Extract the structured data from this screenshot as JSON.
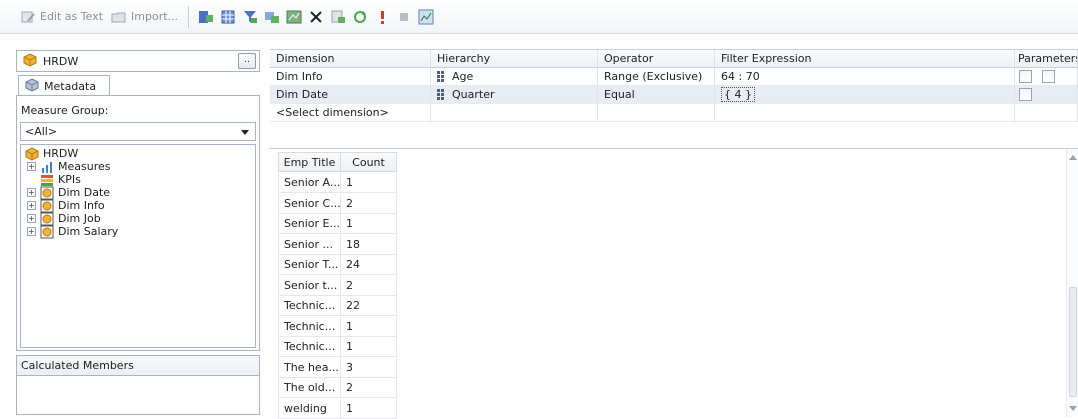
{
  "toolbar": {
    "edit_as_text": "Edit as Text",
    "import": "Import..."
  },
  "left_pane": {
    "cube": "HRDW",
    "browse": "..",
    "metadata_tab": "Metadata",
    "measure_group_label": "Measure Group:",
    "measure_group_value": "<All>",
    "tree": [
      {
        "label": "HRDW",
        "icon": "cube-icon",
        "expander": false,
        "indent": 0
      },
      {
        "label": "Measures",
        "icon": "measures-icon",
        "expander": true,
        "indent": 1
      },
      {
        "label": "KPIs",
        "icon": "kpi-icon",
        "expander": false,
        "indent": 1
      },
      {
        "label": "Dim Date",
        "icon": "dimension-icon",
        "expander": true,
        "indent": 1
      },
      {
        "label": "Dim Info",
        "icon": "dimension-icon",
        "expander": true,
        "indent": 1
      },
      {
        "label": "Dim Job",
        "icon": "dimension-icon",
        "expander": true,
        "indent": 1
      },
      {
        "label": "Dim Salary",
        "icon": "dimension-icon",
        "expander": true,
        "indent": 1
      }
    ],
    "calculated_members": "Calculated Members"
  },
  "filter_grid": {
    "columns": [
      "Dimension",
      "Hierarchy",
      "Operator",
      "Filter Expression",
      "Parameters"
    ],
    "rows": [
      {
        "dimension": "Dim Info",
        "hierarchy": "Age",
        "operator": "Range (Exclusive)",
        "expression": "64 : 70"
      },
      {
        "dimension": "Dim Date",
        "hierarchy": "Quarter",
        "operator": "Equal",
        "expression": "{ 4 }"
      }
    ],
    "select_dimension": "<Select dimension>"
  },
  "results": {
    "columns": [
      "Emp Title",
      "Count"
    ],
    "rows": [
      [
        "Senior A...",
        "1"
      ],
      [
        "Senior C...",
        "2"
      ],
      [
        "Senior E...",
        "1"
      ],
      [
        "Senior ...",
        "18"
      ],
      [
        "Senior T...",
        "24"
      ],
      [
        "Senior t...",
        "2"
      ],
      [
        "Technic...",
        "22"
      ],
      [
        "Technic...",
        "1"
      ],
      [
        "Technic...",
        "1"
      ],
      [
        "The hea...",
        "3"
      ],
      [
        "The old...",
        "2"
      ],
      [
        "welding",
        "1"
      ]
    ]
  },
  "colors": {
    "accent": "#4a5e8a",
    "border": "#a9b3c4",
    "selected_row": "#e8ecf3"
  }
}
